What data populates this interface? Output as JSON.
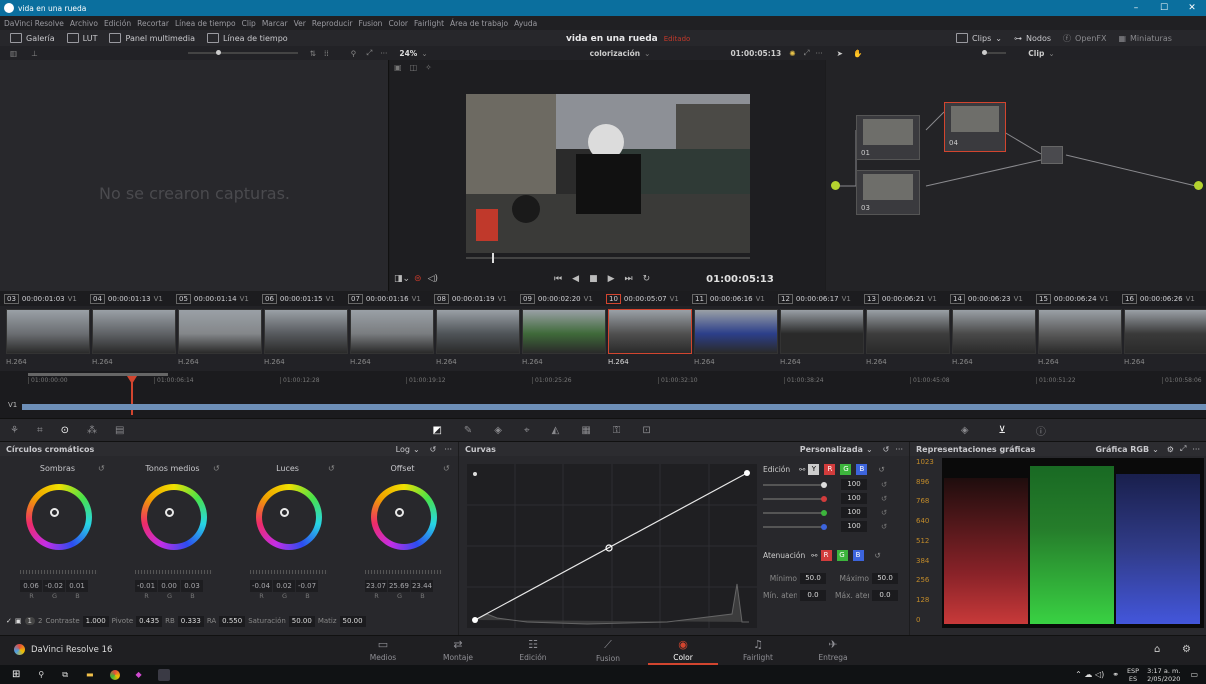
{
  "window": {
    "title": "vida en una rueda",
    "minimize": "–",
    "maximize": "☐",
    "close": "✕"
  },
  "menu": [
    "DaVinci Resolve",
    "Archivo",
    "Edición",
    "Recortar",
    "Línea de tiempo",
    "Clip",
    "Marcar",
    "Ver",
    "Reproducir",
    "Fusion",
    "Color",
    "Fairlight",
    "Área de trabajo",
    "Ayuda"
  ],
  "toolbar": {
    "gallery": "Galería",
    "lut": "LUT",
    "media_pool": "Panel multimedia",
    "timeline": "Línea de tiempo",
    "project_title": "vida en una rueda",
    "edited": "Editado",
    "clips": "Clips",
    "nodes": "Nodos",
    "openfx": "OpenFX",
    "thumbnails": "Miniaturas"
  },
  "viewer": {
    "zoom": "24%",
    "mode": "colorización",
    "timecode_top": "01:00:05:13",
    "timecode": "01:00:05:13",
    "no_stills": "No se crearon capturas.",
    "node_mode": "Clip"
  },
  "nodes": [
    {
      "label": "01"
    },
    {
      "label": "04"
    },
    {
      "label": "03"
    }
  ],
  "clips": [
    {
      "n": "03",
      "tc": "00:00:01:03",
      "tr": "V1",
      "codec": "H.264"
    },
    {
      "n": "04",
      "tc": "00:00:01:13",
      "tr": "V1",
      "codec": "H.264"
    },
    {
      "n": "05",
      "tc": "00:00:01:14",
      "tr": "V1",
      "codec": "H.264"
    },
    {
      "n": "06",
      "tc": "00:00:01:15",
      "tr": "V1",
      "codec": "H.264"
    },
    {
      "n": "07",
      "tc": "00:00:01:16",
      "tr": "V1",
      "codec": "H.264"
    },
    {
      "n": "08",
      "tc": "00:00:01:19",
      "tr": "V1",
      "codec": "H.264"
    },
    {
      "n": "09",
      "tc": "00:00:02:20",
      "tr": "V1",
      "codec": "H.264"
    },
    {
      "n": "10",
      "tc": "00:00:05:07",
      "tr": "V1",
      "codec": "H.264"
    },
    {
      "n": "11",
      "tc": "00:00:06:16",
      "tr": "V1",
      "codec": "H.264"
    },
    {
      "n": "12",
      "tc": "00:00:06:17",
      "tr": "V1",
      "codec": "H.264"
    },
    {
      "n": "13",
      "tc": "00:00:06:21",
      "tr": "V1",
      "codec": "H.264"
    },
    {
      "n": "14",
      "tc": "00:00:06:23",
      "tr": "V1",
      "codec": "H.264"
    },
    {
      "n": "15",
      "tc": "00:00:06:24",
      "tr": "V1",
      "codec": "H.264"
    },
    {
      "n": "16",
      "tc": "00:00:06:26",
      "tr": "V1",
      "codec": "H.264"
    }
  ],
  "ruler": [
    "01:00:00:00",
    "01:00:06:14",
    "01:00:12:28",
    "01:00:19:12",
    "01:00:25:26",
    "01:00:32:10",
    "01:00:38:24",
    "01:00:45:08",
    "01:00:51:22",
    "01:00:58:06"
  ],
  "track": "V1",
  "wheels": {
    "title": "Círculos cromáticos",
    "mode": "Log",
    "items": [
      {
        "name": "Sombras",
        "vals": [
          "0.06",
          "-0.02",
          "0.01"
        ]
      },
      {
        "name": "Tonos medios",
        "vals": [
          "-0.01",
          "0.00",
          "0.03"
        ]
      },
      {
        "name": "Luces",
        "vals": [
          "-0.04",
          "0.02",
          "-0.07"
        ]
      },
      {
        "name": "Offset",
        "vals": [
          "23.07",
          "25.69",
          "23.44"
        ]
      }
    ],
    "rgb": [
      "R",
      "G",
      "B"
    ],
    "bottom": {
      "page1": "1",
      "page2": "2",
      "contrast_lbl": "Contraste",
      "contrast": "1.000",
      "pivot_lbl": "Pivote",
      "pivot": "0.435",
      "rb_lbl": "RB",
      "rb": "0.333",
      "ra_lbl": "RA",
      "ra": "0.550",
      "sat_lbl": "Saturación",
      "sat": "50.00",
      "hue_lbl": "Matiz",
      "hue": "50.00"
    }
  },
  "curves": {
    "title": "Curvas",
    "custom": "Personalizada",
    "edit_lbl": "Edición",
    "y": "Y",
    "r": "R",
    "g": "G",
    "b": "B",
    "intensity": [
      "100",
      "100",
      "100",
      "100"
    ],
    "soft_lbl": "Atenuación",
    "min_lbl": "Mínimo",
    "min": "50.0",
    "max_lbl": "Máximo",
    "max": "50.0",
    "minlow_lbl": "Mín. atenuación",
    "minlow": "0.0",
    "maxlow_lbl": "Máx. atenuación",
    "maxlow": "0.0"
  },
  "scopes": {
    "title": "Representaciones gráficas",
    "mode": "Gráfica RGB",
    "ticks": [
      "1023",
      "896",
      "768",
      "640",
      "512",
      "384",
      "256",
      "128",
      "0"
    ]
  },
  "pages": [
    {
      "name": "Medios"
    },
    {
      "name": "Montaje"
    },
    {
      "name": "Edición"
    },
    {
      "name": "Fusion"
    },
    {
      "name": "Color"
    },
    {
      "name": "Fairlight"
    },
    {
      "name": "Entrega"
    }
  ],
  "app_name": "DaVinci Resolve 16",
  "taskbar": {
    "lang": "ESP",
    "lang2": "ES",
    "time": "3:17 a. m.",
    "date": "2/05/2020"
  },
  "colors": {
    "accent": "#e64b3c",
    "blue": "#0b6f9e"
  }
}
